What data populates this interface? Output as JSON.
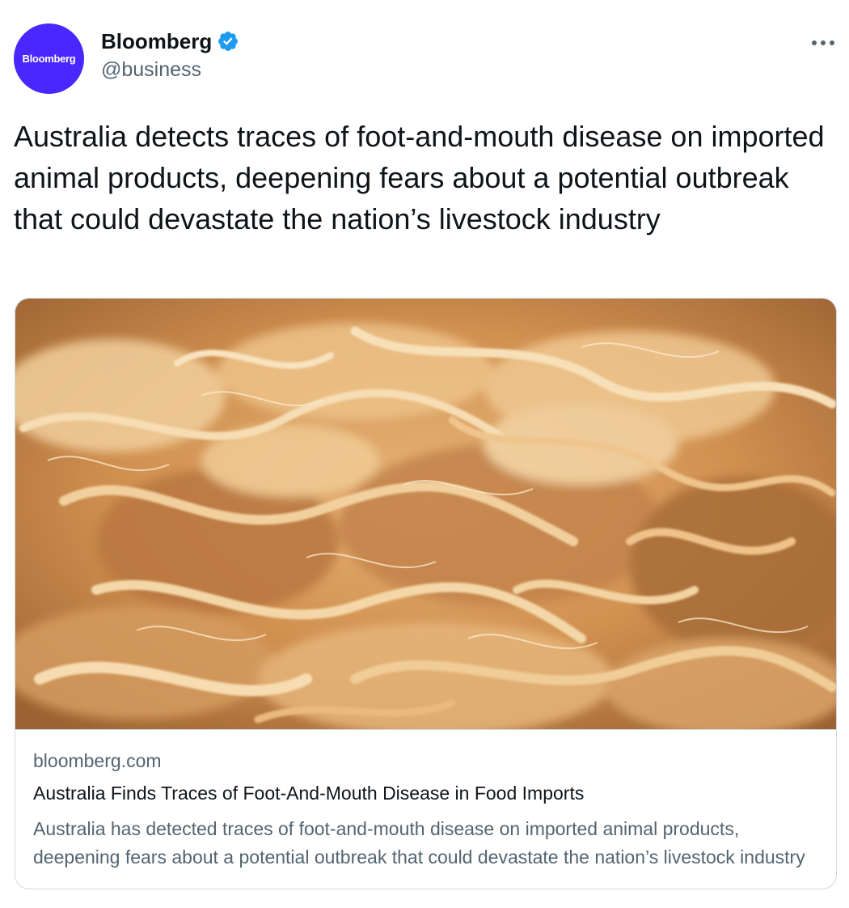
{
  "author": {
    "avatar_text": "Bloomberg",
    "avatar_color": "#4a26ff",
    "display_name": "Bloomberg",
    "verified_icon": "verified-badge-icon",
    "verified_color": "#1d9bf0",
    "handle": "@business"
  },
  "menu": {
    "icon": "more-horizontal-icon"
  },
  "tweet": {
    "text": "Australia detects traces of foot-and-mouth disease on imported animal products, deepening fears about a potential outbreak that could devastate the nation’s livestock industry"
  },
  "card": {
    "domain": "bloomberg.com",
    "title": "Australia Finds Traces of Foot-And-Mouth Disease in Food Imports",
    "description": "Australia has detected traces of foot-and-mouth disease on imported animal products, deepening fears about a potential outbreak that could devastate the nation’s livestock industry"
  }
}
